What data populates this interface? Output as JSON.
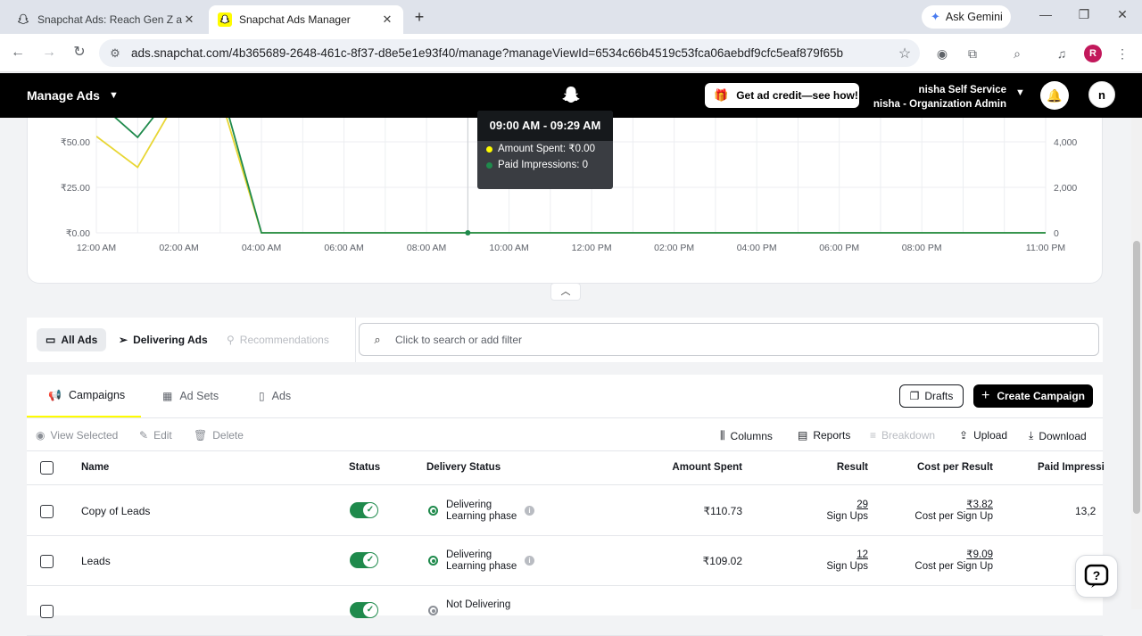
{
  "browser": {
    "tabs": [
      {
        "title": "Snapchat Ads: Reach Gen Z and",
        "active": false
      },
      {
        "title": "Snapchat Ads Manager",
        "active": true
      }
    ],
    "ask_gemini": "Ask Gemini",
    "url": "ads.snapchat.com/4b365689-2648-461c-8f37-d8e5e1e93f40/manage?manageViewId=6534c66b4519c53fca06aebdf9cfc5eaf879f65b",
    "profile_initial": "R"
  },
  "appbar": {
    "menu_label": "Manage Ads",
    "credit_button": "Get ad credit—see how!",
    "account_name": "nisha Self Service",
    "account_role": "nisha - Organization Admin",
    "user_initial": "n"
  },
  "chart_data": {
    "type": "line",
    "x": [
      "12:00 AM",
      "01:00 AM",
      "02:00 AM",
      "03:00 AM",
      "04:00 AM",
      "05:00 AM",
      "06:00 AM",
      "07:00 AM",
      "08:00 AM",
      "09:00 AM",
      "10:00 AM",
      "11:00 AM",
      "12:00 PM",
      "01:00 PM",
      "02:00 PM",
      "03:00 PM",
      "04:00 PM",
      "05:00 PM",
      "06:00 PM",
      "07:00 PM",
      "08:00 PM",
      "09:00 PM",
      "10:00 PM",
      "11:00 PM"
    ],
    "x_tick_labels": [
      "12:00 AM",
      "02:00 AM",
      "04:00 AM",
      "06:00 AM",
      "08:00 AM",
      "10:00 AM",
      "12:00 PM",
      "02:00 PM",
      "04:00 PM",
      "06:00 PM",
      "08:00 PM",
      "11:00 PM"
    ],
    "y_left_ticks": [
      "₹0.00",
      "₹25.00",
      "₹50.00"
    ],
    "y_right_ticks": [
      "0",
      "2,000",
      "4,000"
    ],
    "ylim_left": [
      0,
      75
    ],
    "ylim_right": [
      0,
      6000
    ],
    "series": [
      {
        "name": "Amount Spent",
        "axis": "left",
        "color": "#e8d634",
        "values": [
          53,
          36,
          75,
          75,
          0,
          0,
          0,
          0,
          0,
          0,
          0,
          0,
          0,
          0,
          0,
          0,
          0,
          0,
          0,
          0,
          0,
          0,
          0,
          0
        ]
      },
      {
        "name": "Paid Impressions",
        "axis": "right",
        "color": "#1f8a4c",
        "values": [
          5800,
          4200,
          6500,
          6500,
          0,
          0,
          0,
          0,
          0,
          0,
          0,
          0,
          0,
          0,
          0,
          0,
          0,
          0,
          0,
          0,
          0,
          0,
          0,
          0
        ]
      }
    ],
    "grid": true,
    "highlight_index": 9
  },
  "tooltip": {
    "time": "09:00 AM - 09:29 AM",
    "line1": "Amount Spent: ₹0.00",
    "line2": "Paid Impressions: 0"
  },
  "filter": {
    "all_ads": "All Ads",
    "delivering_ads": "Delivering Ads",
    "recommendations": "Recommendations",
    "search_placeholder": "Click to search or add filter"
  },
  "subtabs": {
    "campaigns": "Campaigns",
    "ad_sets": "Ad Sets",
    "ads": "Ads",
    "drafts": "Drafts",
    "create": "Create Campaign"
  },
  "actions": {
    "view_selected": "View Selected",
    "edit": "Edit",
    "delete": "Delete",
    "columns": "Columns",
    "reports": "Reports",
    "breakdown": "Breakdown",
    "upload": "Upload",
    "download": "Download"
  },
  "table": {
    "headers": {
      "name": "Name",
      "status": "Status",
      "delivery": "Delivery Status",
      "amount": "Amount Spent",
      "result": "Result",
      "cost": "Cost per Result",
      "impressions": "Paid Impressi"
    },
    "rows": [
      {
        "name": "Copy of Leads",
        "delivery1": "Delivering",
        "delivery2": "Learning phase",
        "amount": "₹110.73",
        "result": "29",
        "result_unit": "Sign Ups",
        "cost": "₹3.82",
        "cost_unit": "Cost per Sign Up",
        "impressions": "13,2"
      },
      {
        "name": "Leads",
        "delivery1": "Delivering",
        "delivery2": "Learning phase",
        "amount": "₹109.02",
        "result": "12",
        "result_unit": "Sign Ups",
        "cost": "₹9.09",
        "cost_unit": "Cost per Sign Up",
        "impressions": ""
      },
      {
        "name": "",
        "delivery1": "Not Delivering",
        "delivery2": "",
        "amount": "",
        "result": "",
        "result_unit": "",
        "cost": "",
        "cost_unit": "",
        "impressions": ""
      }
    ]
  }
}
